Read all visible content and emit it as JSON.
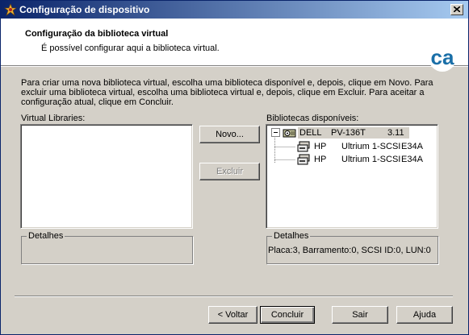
{
  "window": {
    "title": "Configuração de dispositivo",
    "close_label": "×"
  },
  "header": {
    "title": "Configuração da biblioteca virtual",
    "subtitle": "É possível configurar aqui a biblioteca virtual.",
    "logo_text": "ca",
    "brand_color": "#1a6fa8"
  },
  "instructions": "Para criar uma nova biblioteca virtual, escolha uma biblioteca disponível e, depois, clique em Novo. Para excluir uma biblioteca virtual, escolha uma biblioteca virtual e, depois, clique em Excluir. Para aceitar a configuração atual, clique em Concluir.",
  "virtual_libraries": {
    "label": "Virtual Libraries:",
    "items": []
  },
  "available_libraries": {
    "label": "Bibliotecas disponíveis:",
    "items": [
      {
        "expander": "⊟",
        "icon": "library-icon",
        "vendor": "DELL",
        "model": "PV-136T",
        "version": "3.11",
        "selected": true
      },
      {
        "icon": "tape-drive-icon",
        "vendor": "HP",
        "model": "Ultrium 1-SCSI",
        "version": "E34A"
      },
      {
        "icon": "tape-drive-icon",
        "vendor": "HP",
        "model": "Ultrium 1-SCSI",
        "version": "E34A"
      }
    ]
  },
  "buttons": {
    "new": "Novo...",
    "delete": "Excluir"
  },
  "details_left": {
    "legend": "Detalhes",
    "text": ""
  },
  "details_right": {
    "legend": "Detalhes",
    "text": "Placa:3, Barramento:0, SCSI ID:0, LUN:0"
  },
  "footer": {
    "back": "< Voltar",
    "finish": "Concluir",
    "exit": "Sair",
    "help": "Ajuda"
  }
}
